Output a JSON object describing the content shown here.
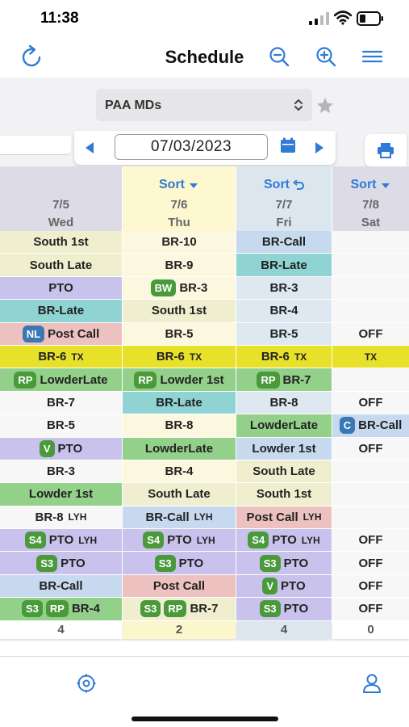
{
  "status": {
    "time": "11:38"
  },
  "nav": {
    "title": "Schedule"
  },
  "toolbar": {
    "group_select": "PAA MDs",
    "date": "07/03/2023"
  },
  "colors": {
    "accent": "#2f7bd6",
    "yellow_tx": "#e8e12a",
    "purple": "#c8c2ec",
    "teal": "#8fd3d3",
    "green": "#93d08a",
    "pink": "#eec1c1",
    "lightblue": "#c7d9ee",
    "beige": "#efefcf",
    "white": "#ffffff"
  },
  "columns": [
    {
      "sort": "",
      "date": "7/5",
      "day": "Wed",
      "total": "4",
      "cells": [
        {
          "badges": [],
          "text": "South 1st",
          "sub": ""
        },
        {
          "badges": [],
          "text": "South Late",
          "sub": ""
        },
        {
          "badges": [],
          "text": "PTO",
          "sub": ""
        },
        {
          "badges": [],
          "text": "BR-Late",
          "sub": ""
        },
        {
          "badges": [
            "NL"
          ],
          "text": "Post Call",
          "sub": ""
        },
        {
          "badges": [],
          "text": "BR-6",
          "sub": "TX"
        },
        {
          "badges": [
            "RP"
          ],
          "text": "LowderLate",
          "sub": ""
        },
        {
          "badges": [],
          "text": "BR-7",
          "sub": ""
        },
        {
          "badges": [],
          "text": "BR-5",
          "sub": ""
        },
        {
          "badges": [
            "V"
          ],
          "text": "PTO",
          "sub": ""
        },
        {
          "badges": [],
          "text": "BR-3",
          "sub": ""
        },
        {
          "badges": [],
          "text": "Lowder 1st",
          "sub": ""
        },
        {
          "badges": [],
          "text": "BR-8",
          "sub": "LYH"
        },
        {
          "badges": [
            "S4"
          ],
          "text": "PTO",
          "sub": "LYH"
        },
        {
          "badges": [
            "S3"
          ],
          "text": "PTO",
          "sub": ""
        },
        {
          "badges": [],
          "text": "BR-Call",
          "sub": ""
        },
        {
          "badges": [
            "S3",
            "RP"
          ],
          "text": "BR-4",
          "sub": ""
        }
      ]
    },
    {
      "sort": "Sort",
      "date": "7/6",
      "day": "Thu",
      "total": "2",
      "cells": [
        {
          "badges": [],
          "text": "BR-10",
          "sub": ""
        },
        {
          "badges": [],
          "text": "BR-9",
          "sub": ""
        },
        {
          "badges": [
            "BW"
          ],
          "text": "BR-3",
          "sub": ""
        },
        {
          "badges": [],
          "text": "South 1st",
          "sub": ""
        },
        {
          "badges": [],
          "text": "BR-5",
          "sub": ""
        },
        {
          "badges": [],
          "text": "BR-6",
          "sub": "TX"
        },
        {
          "badges": [
            "RP"
          ],
          "text": "Lowder 1st",
          "sub": ""
        },
        {
          "badges": [],
          "text": "BR-Late",
          "sub": ""
        },
        {
          "badges": [],
          "text": "BR-8",
          "sub": ""
        },
        {
          "badges": [],
          "text": "LowderLate",
          "sub": ""
        },
        {
          "badges": [],
          "text": "BR-4",
          "sub": ""
        },
        {
          "badges": [],
          "text": "South Late",
          "sub": ""
        },
        {
          "badges": [],
          "text": "BR-Call",
          "sub": "LYH"
        },
        {
          "badges": [
            "S4"
          ],
          "text": "PTO",
          "sub": "LYH"
        },
        {
          "badges": [
            "S3"
          ],
          "text": "PTO",
          "sub": ""
        },
        {
          "badges": [],
          "text": "Post Call",
          "sub": ""
        },
        {
          "badges": [
            "S3",
            "RP"
          ],
          "text": "BR-7",
          "sub": ""
        }
      ]
    },
    {
      "sort": "Sort",
      "date": "7/7",
      "day": "Fri",
      "total": "4",
      "cells": [
        {
          "badges": [],
          "text": "BR-Call",
          "sub": ""
        },
        {
          "badges": [],
          "text": "BR-Late",
          "sub": ""
        },
        {
          "badges": [],
          "text": "BR-3",
          "sub": ""
        },
        {
          "badges": [],
          "text": "BR-4",
          "sub": ""
        },
        {
          "badges": [],
          "text": "BR-5",
          "sub": ""
        },
        {
          "badges": [],
          "text": "BR-6",
          "sub": "TX"
        },
        {
          "badges": [
            "RP"
          ],
          "text": "BR-7",
          "sub": ""
        },
        {
          "badges": [],
          "text": "BR-8",
          "sub": ""
        },
        {
          "badges": [],
          "text": "LowderLate",
          "sub": ""
        },
        {
          "badges": [],
          "text": "Lowder 1st",
          "sub": ""
        },
        {
          "badges": [],
          "text": "South Late",
          "sub": ""
        },
        {
          "badges": [],
          "text": "South 1st",
          "sub": ""
        },
        {
          "badges": [],
          "text": "Post Call",
          "sub": "LYH"
        },
        {
          "badges": [
            "S4"
          ],
          "text": "PTO",
          "sub": "LYH"
        },
        {
          "badges": [
            "S3"
          ],
          "text": "PTO",
          "sub": ""
        },
        {
          "badges": [
            "V"
          ],
          "text": "PTO",
          "sub": ""
        },
        {
          "badges": [
            "S3"
          ],
          "text": "PTO",
          "sub": ""
        }
      ]
    },
    {
      "sort": "Sort",
      "date": "7/8",
      "day": "Sat",
      "total": "0",
      "cells": [
        {
          "badges": [],
          "text": "",
          "sub": ""
        },
        {
          "badges": [],
          "text": "",
          "sub": ""
        },
        {
          "badges": [],
          "text": "",
          "sub": ""
        },
        {
          "badges": [],
          "text": "",
          "sub": ""
        },
        {
          "badges": [],
          "text": "OFF",
          "sub": ""
        },
        {
          "badges": [],
          "text": "",
          "sub": "TX"
        },
        {
          "badges": [],
          "text": "",
          "sub": ""
        },
        {
          "badges": [],
          "text": "OFF",
          "sub": ""
        },
        {
          "badges": [
            "C"
          ],
          "text": "BR-Call",
          "sub": ""
        },
        {
          "badges": [],
          "text": "OFF",
          "sub": ""
        },
        {
          "badges": [],
          "text": "",
          "sub": ""
        },
        {
          "badges": [],
          "text": "",
          "sub": ""
        },
        {
          "badges": [],
          "text": "",
          "sub": ""
        },
        {
          "badges": [],
          "text": "OFF",
          "sub": ""
        },
        {
          "badges": [],
          "text": "OFF",
          "sub": ""
        },
        {
          "badges": [],
          "text": "OFF",
          "sub": ""
        },
        {
          "badges": [],
          "text": "OFF",
          "sub": ""
        }
      ]
    }
  ]
}
